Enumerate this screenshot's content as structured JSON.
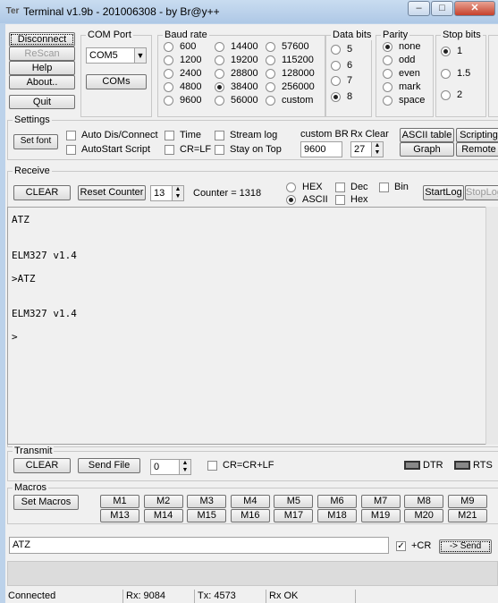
{
  "window": {
    "title": "Terminal v1.9b - 201006308 - by Br@y++",
    "icon_text": "Ter"
  },
  "top_buttons": {
    "disconnect": "Disconnect",
    "rescan": "ReScan",
    "help": "Help",
    "about": "About..",
    "quit": "Quit"
  },
  "com_port": {
    "label": "COM Port",
    "value": "COM5",
    "coms_button": "COMs"
  },
  "baud_rate": {
    "label": "Baud rate",
    "options": [
      "600",
      "1200",
      "2400",
      "4800",
      "9600",
      "14400",
      "19200",
      "28800",
      "38400",
      "56000",
      "57600",
      "115200",
      "128000",
      "256000",
      "custom"
    ],
    "selected": "38400"
  },
  "data_bits": {
    "label": "Data bits",
    "options": [
      "5",
      "6",
      "7",
      "8"
    ],
    "selected": "8"
  },
  "parity": {
    "label": "Parity",
    "options": [
      "none",
      "odd",
      "even",
      "mark",
      "space"
    ],
    "selected": "none"
  },
  "stop_bits": {
    "label": "Stop bits",
    "options": [
      "1",
      "1.5",
      "2"
    ],
    "selected": "1"
  },
  "settings": {
    "label": "Settings",
    "set_font": "Set font",
    "auto_dis_connect": "Auto Dis/Connect",
    "autostart_script": "AutoStart Script",
    "time": "Time",
    "cr_lf": "CR=LF",
    "stream_log": "Stream log",
    "stay_on_top": "Stay on Top",
    "custom_br_label": "custom BR",
    "custom_br_value": "9600",
    "rx_clear_label": "Rx Clear",
    "rx_clear_value": "27",
    "ascii_table": "ASCII table",
    "graph": "Graph",
    "scripting": "Scripting",
    "remote": "Remote"
  },
  "receive": {
    "label": "Receive",
    "clear": "CLEAR",
    "reset_counter": "Reset Counter",
    "counter_spin": "13",
    "counter_label": "Counter = 1318",
    "hex": "HEX",
    "ascii": "ASCII",
    "selected_mode": "ASCII",
    "dec": "Dec",
    "hex_check": "Hex",
    "bin": "Bin",
    "start_log": "StartLog",
    "stop_log": "StopLog"
  },
  "terminal_lines": [
    "ATZ",
    "",
    "ELM327 v1.4",
    "",
    ">ATZ",
    "",
    "ELM327 v1.4",
    "",
    ">"
  ],
  "transmit": {
    "label": "Transmit",
    "clear": "CLEAR",
    "send_file": "Send File",
    "spin_value": "0",
    "cr_crlf": "CR=CR+LF",
    "dtr": "DTR",
    "rts": "RTS"
  },
  "macros": {
    "label": "Macros",
    "set_macros": "Set Macros",
    "row1": [
      "M1",
      "M2",
      "M3",
      "M4",
      "M5",
      "M6",
      "M7",
      "M8",
      "M9"
    ],
    "row2": [
      "M13",
      "M14",
      "M15",
      "M16",
      "M17",
      "M18",
      "M19",
      "M20",
      "M21"
    ]
  },
  "send_bar": {
    "input_value": "ATZ",
    "cr_label": "+CR",
    "send_button": "-> Send"
  },
  "statusbar": {
    "connected": "Connected",
    "rx": "Rx: 9084",
    "tx": "Tx: 4573",
    "rx_ok": "Rx OK"
  }
}
